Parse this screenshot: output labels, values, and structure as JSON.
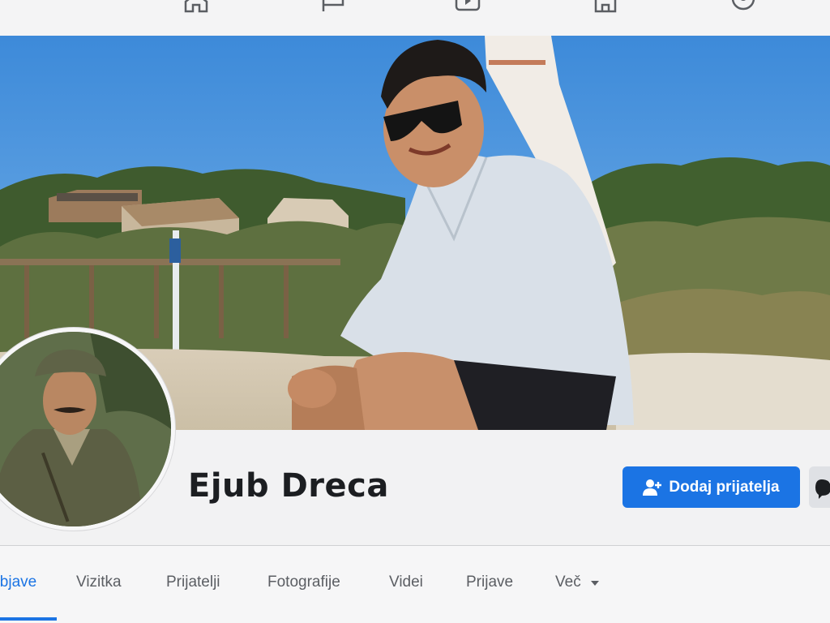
{
  "top_nav": {
    "icons": [
      "home-icon",
      "flag-icon",
      "video-icon",
      "marketplace-icon",
      "groups-icon"
    ]
  },
  "cover_photo": {
    "description_icon": "cover-photo"
  },
  "profile": {
    "name": "Ejub Dreca",
    "add_friend_label": "Dodaj prijatelja"
  },
  "tabs": [
    {
      "label": "Objave",
      "active": true
    },
    {
      "label": "Vizitka",
      "active": false
    },
    {
      "label": "Prijatelji",
      "active": false
    },
    {
      "label": "Fotografije",
      "active": false
    },
    {
      "label": "Videi",
      "active": false
    },
    {
      "label": "Prijave",
      "active": false
    },
    {
      "label": "Več",
      "active": false
    }
  ],
  "colors": {
    "accent": "#1b74e4",
    "name_text": "#1c1e21",
    "tab_text": "#5b5e63"
  }
}
